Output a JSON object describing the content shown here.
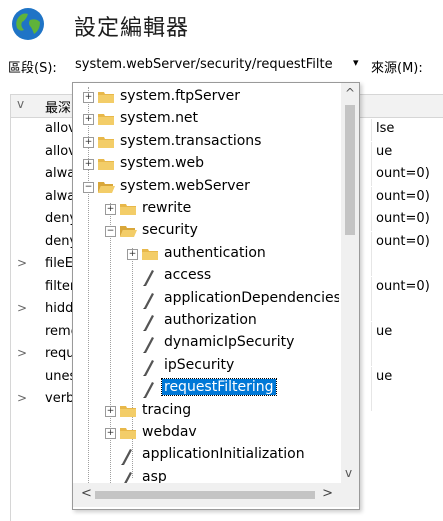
{
  "header": {
    "title": "設定編輯器"
  },
  "section_bar": {
    "section_label": "區段(S):",
    "section_value": "system.webServer/security/requestFilte",
    "dropdown_arrow": "▾",
    "from_label": "來源(M):"
  },
  "grid": {
    "header_name": "最深",
    "rows": [
      {
        "expander": "",
        "name": "allov",
        "value": "lse"
      },
      {
        "expander": "",
        "name": "allov",
        "value": "ue"
      },
      {
        "expander": "",
        "name": "alwa",
        "value": "ount=0)"
      },
      {
        "expander": "",
        "name": "alwa",
        "value": "ount=0)"
      },
      {
        "expander": "",
        "name": "deny",
        "value": "ount=0)"
      },
      {
        "expander": "",
        "name": "deny",
        "value": "ount=0)"
      },
      {
        "expander": ">",
        "name": "fileE",
        "value": ""
      },
      {
        "expander": "",
        "name": "filter",
        "value": "ount=0)"
      },
      {
        "expander": ">",
        "name": "hidd",
        "value": ""
      },
      {
        "expander": "",
        "name": "remo",
        "value": "ue"
      },
      {
        "expander": ">",
        "name": "requ",
        "value": ""
      },
      {
        "expander": "",
        "name": "unes",
        "value": "ue"
      },
      {
        "expander": ">",
        "name": "verb",
        "value": ""
      }
    ],
    "header_expander": "v"
  },
  "tree": {
    "nodes": [
      {
        "label": "system.ftpServer",
        "toggle": "+",
        "kind": "folder"
      },
      {
        "label": "system.net",
        "toggle": "+",
        "kind": "folder"
      },
      {
        "label": "system.transactions",
        "toggle": "+",
        "kind": "folder"
      },
      {
        "label": "system.web",
        "toggle": "+",
        "kind": "folder"
      },
      {
        "label": "system.webServer",
        "toggle": "−",
        "kind": "folder-open"
      },
      {
        "label": "rewrite",
        "toggle": "+",
        "kind": "folder"
      },
      {
        "label": "security",
        "toggle": "−",
        "kind": "folder-open"
      },
      {
        "label": "authentication",
        "toggle": "+",
        "kind": "folder"
      },
      {
        "label": "access",
        "toggle": "",
        "kind": "leaf"
      },
      {
        "label": "applicationDependencies",
        "toggle": "",
        "kind": "leaf"
      },
      {
        "label": "authorization",
        "toggle": "",
        "kind": "leaf"
      },
      {
        "label": "dynamicIpSecurity",
        "toggle": "",
        "kind": "leaf"
      },
      {
        "label": "ipSecurity",
        "toggle": "",
        "kind": "leaf"
      },
      {
        "label": "requestFiltering",
        "toggle": "",
        "kind": "leaf",
        "selected": true
      },
      {
        "label": "tracing",
        "toggle": "+",
        "kind": "folder"
      },
      {
        "label": "webdav",
        "toggle": "+",
        "kind": "folder"
      },
      {
        "label": "applicationInitialization",
        "toggle": "",
        "kind": "leaf"
      },
      {
        "label": "asp",
        "toggle": "",
        "kind": "leaf"
      }
    ]
  },
  "scroll": {
    "up": "^",
    "down": "v",
    "left": "<",
    "right": ">"
  },
  "colors": {
    "selection": "#0078d7",
    "folder": "#e8b84a"
  }
}
